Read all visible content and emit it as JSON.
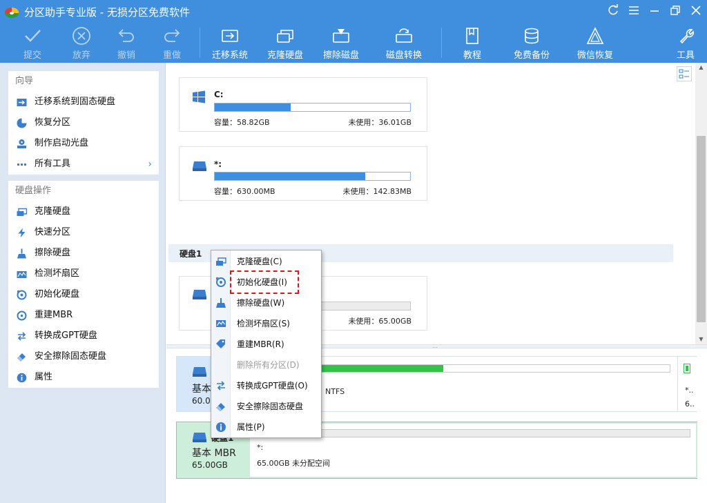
{
  "window": {
    "title": "分区助手专业版 - 无损分区免费软件"
  },
  "toolbar": {
    "commit": "提交",
    "discard": "放弃",
    "undo": "撤销",
    "redo": "重做",
    "migrate_os": "迁移系统",
    "clone_disk": "克隆硬盘",
    "wipe_disk": "擦除磁盘",
    "convert_disk": "磁盘转换",
    "tutorial": "教程",
    "free_backup": "免费备份",
    "wechat_restore": "微信恢复",
    "tools": "工具"
  },
  "sidebar": {
    "wizard": {
      "header": "向导",
      "items": [
        {
          "label": "迁移系统到固态硬盘",
          "icon": "migrate-icon"
        },
        {
          "label": "恢复分区",
          "icon": "recover-icon"
        },
        {
          "label": "制作启动光盘",
          "icon": "bootdisk-icon"
        },
        {
          "label": "所有工具",
          "icon": "dots-icon"
        }
      ]
    },
    "disk_ops": {
      "header": "硬盘操作",
      "items": [
        {
          "label": "克隆硬盘",
          "icon": "clone-icon"
        },
        {
          "label": "快速分区",
          "icon": "lightning-icon"
        },
        {
          "label": "擦除硬盘",
          "icon": "broom-icon"
        },
        {
          "label": "检测坏扇区",
          "icon": "chart-icon"
        },
        {
          "label": "初始化硬盘",
          "icon": "init-icon"
        },
        {
          "label": "重建MBR",
          "icon": "rebuild-icon"
        },
        {
          "label": "转换成GPT硬盘",
          "icon": "convert-icon"
        },
        {
          "label": "安全擦除固态硬盘",
          "icon": "eraser-icon"
        },
        {
          "label": "属性",
          "icon": "info-icon"
        }
      ]
    }
  },
  "partitions": [
    {
      "letter": "C:",
      "capacity": "容量：58.82GB",
      "unused": "未使用：36.01GB",
      "used_fraction": 0.39
    },
    {
      "letter": "*:",
      "capacity": "容量：630.00MB",
      "unused": "未使用：142.83MB",
      "used_fraction": 0.77
    }
  ],
  "disk1": {
    "header": "硬盘1",
    "unused": "未使用：65.00GB"
  },
  "diskmap": {
    "row1": {
      "type": "基本",
      "size_prefix": "60.0",
      "fs": "NTFS",
      "side_label": "*..",
      "side_size": "6.."
    },
    "row2": {
      "title": "硬盘1",
      "type": "基本 MBR",
      "size": "65.00GB",
      "part_label": "*:",
      "part_desc": "65.00GB 未分配空间"
    }
  },
  "context_menu": {
    "items": [
      {
        "label": "克隆硬盘(C)",
        "icon": "clone-icon",
        "disabled": false
      },
      {
        "label": "初始化硬盘(I)",
        "icon": "init-icon",
        "disabled": false
      },
      {
        "label": "擦除硬盘(W)",
        "icon": "broom-icon",
        "disabled": false
      },
      {
        "label": "检测坏扇区(S)",
        "icon": "chart-icon",
        "disabled": false
      },
      {
        "label": "重建MBR(R)",
        "icon": "tag-icon",
        "disabled": false
      },
      {
        "label": "删除所有分区(D)",
        "icon": "",
        "disabled": true
      },
      {
        "label": "转换成GPT硬盘(O)",
        "icon": "convert-icon",
        "disabled": false
      },
      {
        "label": "安全擦除固态硬盘",
        "icon": "eraser-icon",
        "disabled": false
      },
      {
        "label": "属性(P)",
        "icon": "info-icon",
        "disabled": false
      }
    ]
  },
  "colors": {
    "accent": "#3f8fde",
    "green": "#33c24a",
    "highlight_border": "#e0141c"
  }
}
